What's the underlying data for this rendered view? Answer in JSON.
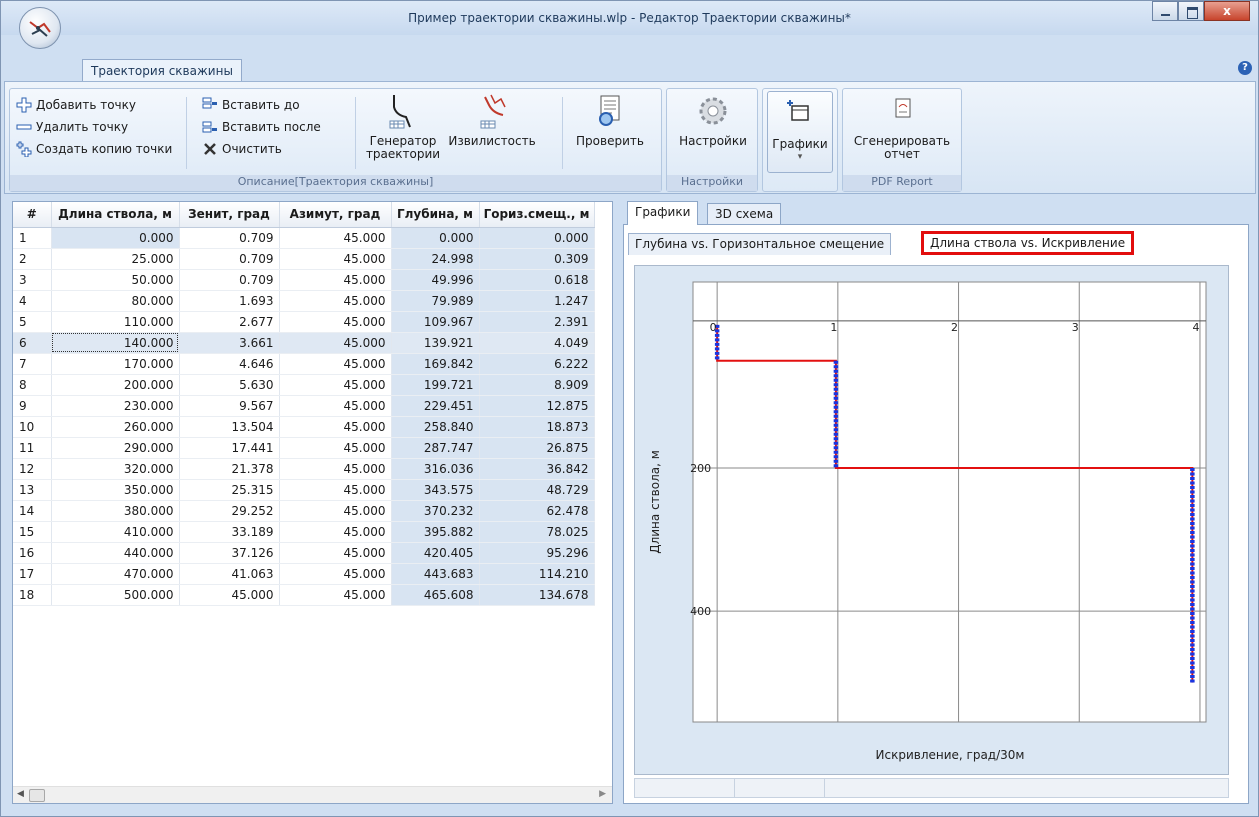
{
  "window": {
    "title": "Пример траектории скважины.wlp - Редактор Траектории скважины*",
    "help_glyph": "?",
    "close_glyph": "x"
  },
  "ribbon": {
    "tab": "Траектория скважины",
    "groups": {
      "description": {
        "caption": "Описание[Траектория скважины]",
        "add_point": "Добавить точку",
        "delete_point": "Удалить точку",
        "copy_point": "Создать копию точки",
        "insert_before": "Вставить до",
        "insert_after": "Вставить после",
        "clear": "Очистить",
        "generator_line1": "Генератор",
        "generator_line2": "траектории",
        "tortuosity": "Извилистость",
        "check": "Проверить"
      },
      "settings": {
        "caption": "Настройки",
        "settings_button": "Настройки"
      },
      "charts": {
        "charts_button": "Графики",
        "dropdown_glyph": "▾"
      },
      "pdf": {
        "caption": "PDF Report",
        "generate_line1": "Сгенерировать",
        "generate_line2": "отчет"
      }
    }
  },
  "table": {
    "columns": [
      "#",
      "Длина ствола, м",
      "Зенит, град",
      "Азимут, град",
      "Глубина, м",
      "Гориз.смещ., м"
    ],
    "rows": [
      [
        "1",
        "0.000",
        "0.709",
        "45.000",
        "0.000",
        "0.000"
      ],
      [
        "2",
        "25.000",
        "0.709",
        "45.000",
        "24.998",
        "0.309"
      ],
      [
        "3",
        "50.000",
        "0.709",
        "45.000",
        "49.996",
        "0.618"
      ],
      [
        "4",
        "80.000",
        "1.693",
        "45.000",
        "79.989",
        "1.247"
      ],
      [
        "5",
        "110.000",
        "2.677",
        "45.000",
        "109.967",
        "2.391"
      ],
      [
        "6",
        "140.000",
        "3.661",
        "45.000",
        "139.921",
        "4.049"
      ],
      [
        "7",
        "170.000",
        "4.646",
        "45.000",
        "169.842",
        "6.222"
      ],
      [
        "8",
        "200.000",
        "5.630",
        "45.000",
        "199.721",
        "8.909"
      ],
      [
        "9",
        "230.000",
        "9.567",
        "45.000",
        "229.451",
        "12.875"
      ],
      [
        "10",
        "260.000",
        "13.504",
        "45.000",
        "258.840",
        "18.873"
      ],
      [
        "11",
        "290.000",
        "17.441",
        "45.000",
        "287.747",
        "26.875"
      ],
      [
        "12",
        "320.000",
        "21.378",
        "45.000",
        "316.036",
        "36.842"
      ],
      [
        "13",
        "350.000",
        "25.315",
        "45.000",
        "343.575",
        "48.729"
      ],
      [
        "14",
        "380.000",
        "29.252",
        "45.000",
        "370.232",
        "62.478"
      ],
      [
        "15",
        "410.000",
        "33.189",
        "45.000",
        "395.882",
        "78.025"
      ],
      [
        "16",
        "440.000",
        "37.126",
        "45.000",
        "420.405",
        "95.296"
      ],
      [
        "17",
        "470.000",
        "41.063",
        "45.000",
        "443.683",
        "114.210"
      ],
      [
        "18",
        "500.000",
        "45.000",
        "45.000",
        "465.608",
        "134.678"
      ]
    ],
    "selected_row": 6,
    "scroll_left": "◀",
    "scroll_right": "▶"
  },
  "right_panel": {
    "tabs": [
      "Графики",
      "3D схема"
    ],
    "chart_tabs": [
      "Глубина vs. Горизонтальное смещение",
      "Длина ствола vs. Искривление"
    ]
  },
  "chart_data": {
    "type": "line",
    "title": "",
    "xlabel": "Искривление, град/30м",
    "ylabel": "Длина ствола, м",
    "x_ticks": [
      "0",
      "1",
      "2",
      "3",
      "4"
    ],
    "y_ticks": [
      "200",
      "400"
    ],
    "xlim": [
      -0.2,
      4.05
    ],
    "ylim": [
      -60,
      555
    ],
    "y_inverted": true,
    "grid": true,
    "series": [
      {
        "color": "#e31010",
        "points": [
          [
            0,
            0
          ],
          [
            0,
            50
          ],
          [
            0.984,
            50
          ],
          [
            0.984,
            200
          ],
          [
            3.937,
            200
          ],
          [
            3.937,
            500
          ]
        ]
      }
    ],
    "markers": {
      "color": "#1a35e0",
      "points": [
        [
          0,
          0
        ],
        [
          0,
          50
        ],
        [
          0.984,
          50
        ],
        [
          0.984,
          200
        ],
        [
          3.937,
          200
        ],
        [
          3.937,
          500
        ]
      ]
    }
  }
}
